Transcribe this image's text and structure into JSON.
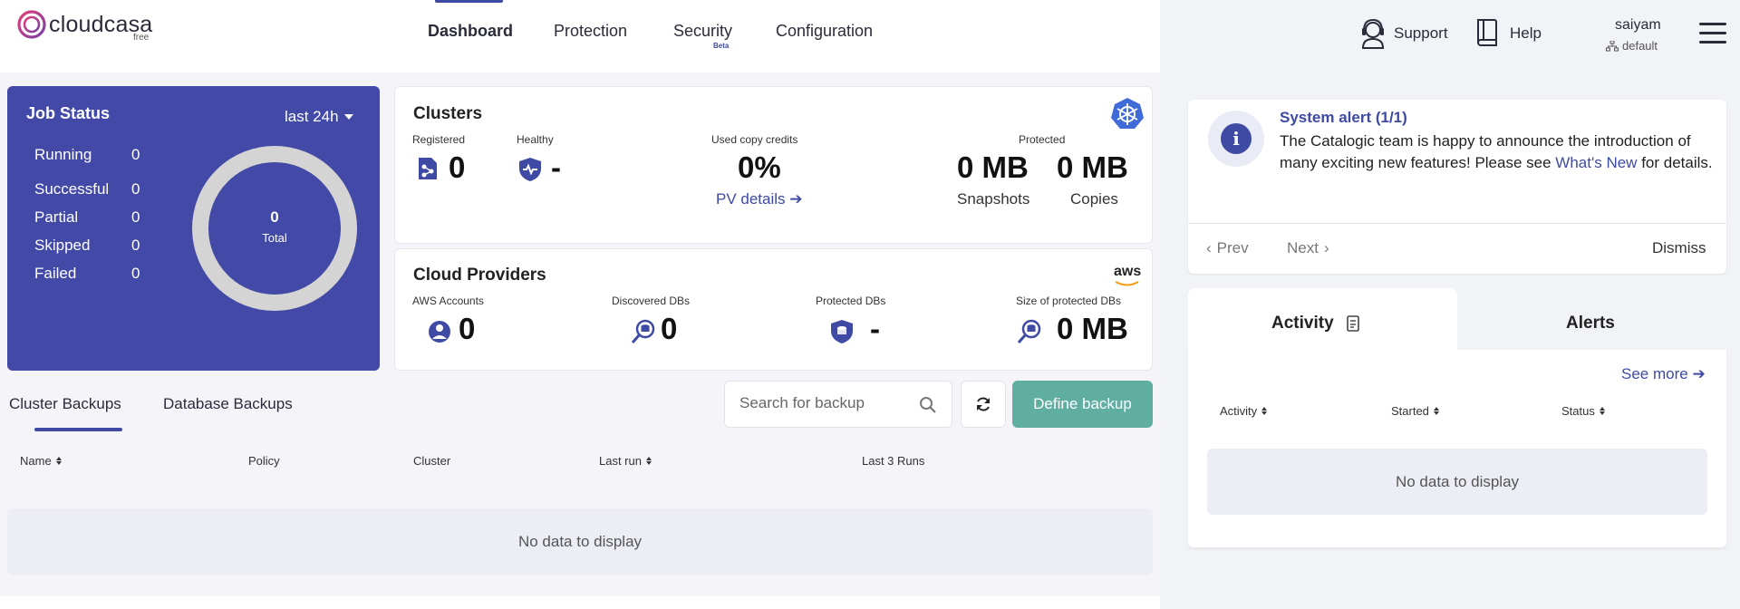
{
  "brand": {
    "name": "cloudcasa",
    "tier": "free"
  },
  "nav": {
    "items": [
      {
        "label": "Dashboard",
        "active": true
      },
      {
        "label": "Protection",
        "active": false
      },
      {
        "label": "Security",
        "active": false,
        "badge": "Beta"
      },
      {
        "label": "Configuration",
        "active": false
      }
    ]
  },
  "topbar": {
    "support_label": "Support",
    "help_label": "Help",
    "user": {
      "name": "saiyam",
      "org": "default"
    }
  },
  "job_status": {
    "title": "Job Status",
    "range": "last 24h",
    "rows": [
      {
        "label": "Running",
        "value": "0"
      },
      {
        "label": "Successful",
        "value": "0"
      },
      {
        "label": "Partial",
        "value": "0"
      },
      {
        "label": "Skipped",
        "value": "0"
      },
      {
        "label": "Failed",
        "value": "0"
      }
    ],
    "total_value": "0",
    "total_label": "Total"
  },
  "clusters": {
    "title": "Clusters",
    "registered_label": "Registered",
    "registered_value": "0",
    "healthy_label": "Healthy",
    "healthy_value": "-",
    "credits_label": "Used copy credits",
    "credits_value": "0%",
    "pv_link": "PV details",
    "protected_label": "Protected",
    "snapshots_value": "0 MB",
    "snapshots_label": "Snapshots",
    "copies_value": "0 MB",
    "copies_label": "Copies"
  },
  "cloud": {
    "title": "Cloud Providers",
    "provider_logo": "aws",
    "aws_accounts_label": "AWS Accounts",
    "aws_accounts_value": "0",
    "discovered_label": "Discovered DBs",
    "discovered_value": "0",
    "protected_label": "Protected DBs",
    "protected_value": "-",
    "size_label": "Size of protected DBs",
    "size_value": "0 MB"
  },
  "backups": {
    "tabs": [
      {
        "label": "Cluster Backups",
        "active": true
      },
      {
        "label": "Database Backups",
        "active": false
      }
    ],
    "search_placeholder": "Search for backup",
    "define_label": "Define backup",
    "columns": [
      "Name",
      "Policy",
      "Cluster",
      "Last run",
      "Last 3 Runs"
    ],
    "empty": "No data to display"
  },
  "alert": {
    "title": "System alert (1/1)",
    "message": "The Catalogic team is happy to announce the introduction of many exciting new features! Please see",
    "link": "What's New",
    "message_end": "for details.",
    "prev": "Prev",
    "next": "Next",
    "dismiss": "Dismiss"
  },
  "activity": {
    "tab_activity": "Activity",
    "tab_alerts": "Alerts",
    "see_more": "See more",
    "columns": [
      "Activity",
      "Started",
      "Status"
    ],
    "empty": "No data to display"
  },
  "colors": {
    "accent": "#3e4aa3",
    "job_status_bg": "#4349a6",
    "define_button": "#5faea0",
    "brand_gradient": [
      "#e0407a",
      "#7a3fa8"
    ]
  }
}
